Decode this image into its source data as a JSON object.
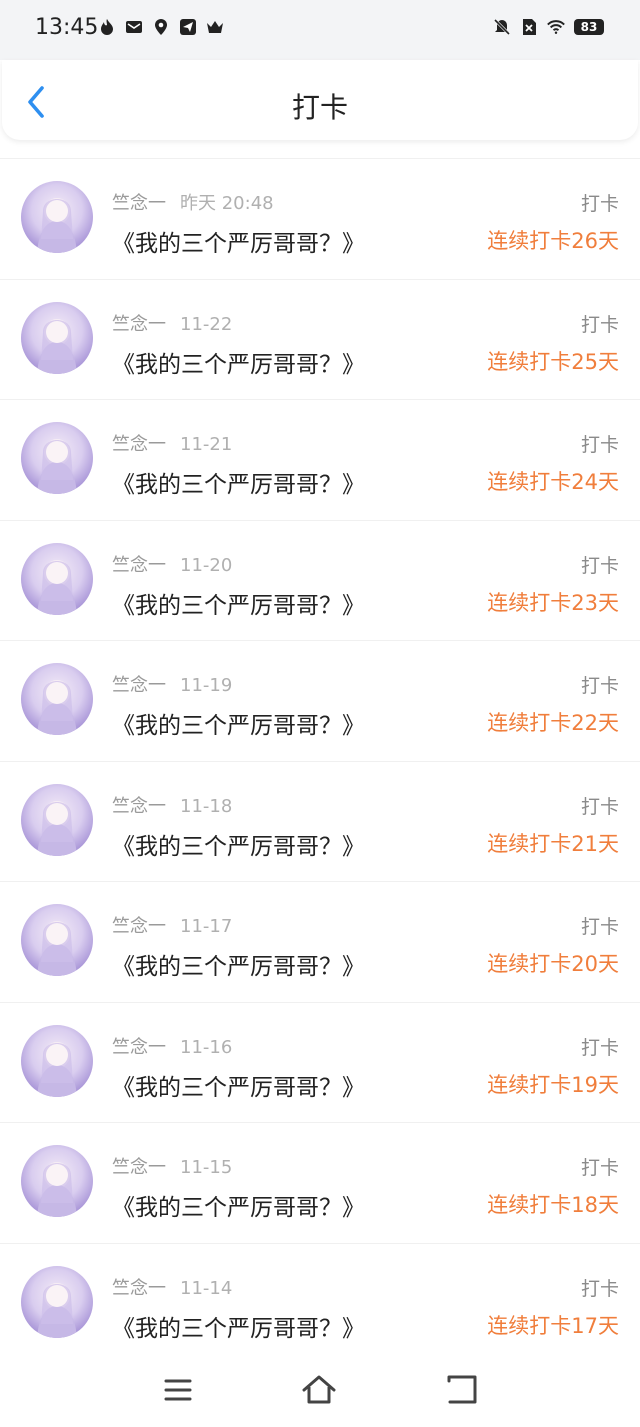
{
  "status": {
    "time": "13:45",
    "battery": "83",
    "icons_left": [
      "flame-icon",
      "mail-icon",
      "location-pin-icon",
      "send-icon",
      "crown-icon"
    ],
    "icons_right": [
      "mute-bell-icon",
      "sim-off-icon",
      "wifi-icon",
      "battery-icon"
    ]
  },
  "header": {
    "title": "打卡",
    "back_icon": "chevron-left-icon"
  },
  "accent_color": "#f07e3c",
  "back_color": "#2e8ff0",
  "items": [
    {
      "user": "竺念一",
      "time": "昨天 20:48",
      "book": "《我的三个严厉哥哥？》",
      "type": "打卡",
      "streak": "连续打卡26天"
    },
    {
      "user": "竺念一",
      "time": "11-22",
      "book": "《我的三个严厉哥哥？》",
      "type": "打卡",
      "streak": "连续打卡25天"
    },
    {
      "user": "竺念一",
      "time": "11-21",
      "book": "《我的三个严厉哥哥？》",
      "type": "打卡",
      "streak": "连续打卡24天"
    },
    {
      "user": "竺念一",
      "time": "11-20",
      "book": "《我的三个严厉哥哥？》",
      "type": "打卡",
      "streak": "连续打卡23天"
    },
    {
      "user": "竺念一",
      "time": "11-19",
      "book": "《我的三个严厉哥哥？》",
      "type": "打卡",
      "streak": "连续打卡22天"
    },
    {
      "user": "竺念一",
      "time": "11-18",
      "book": "《我的三个严厉哥哥？》",
      "type": "打卡",
      "streak": "连续打卡21天"
    },
    {
      "user": "竺念一",
      "time": "11-17",
      "book": "《我的三个严厉哥哥？》",
      "type": "打卡",
      "streak": "连续打卡20天"
    },
    {
      "user": "竺念一",
      "time": "11-16",
      "book": "《我的三个严厉哥哥？》",
      "type": "打卡",
      "streak": "连续打卡19天"
    },
    {
      "user": "竺念一",
      "time": "11-15",
      "book": "《我的三个严厉哥哥？》",
      "type": "打卡",
      "streak": "连续打卡18天"
    },
    {
      "user": "竺念一",
      "time": "11-14",
      "book": "《我的三个严厉哥哥？》",
      "type": "打卡",
      "streak": "连续打卡17天"
    }
  ],
  "nav": {
    "icons": [
      "menu-icon",
      "home-icon",
      "back-icon"
    ]
  }
}
